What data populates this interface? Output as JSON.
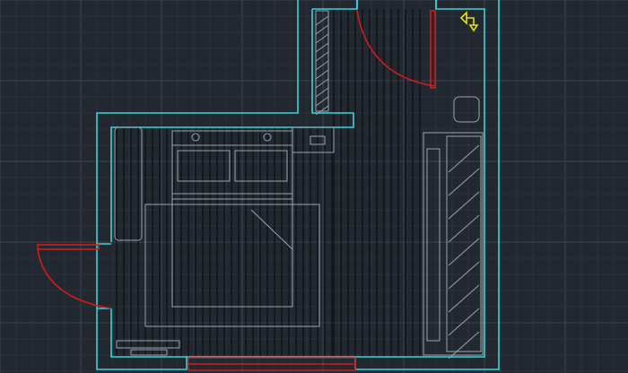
{
  "drawing": {
    "background_color": "#212830",
    "grid_major_color": "#3a4553",
    "grid_minor_color": "#2a323c",
    "wall_color": "#30d8e0",
    "furniture_color": "#9aa3ad",
    "floor_line_color": "#0b0d10",
    "door_color": "#d21b1b",
    "ucs_icon_color": "#e8e200",
    "grid_visible": true,
    "elements": [
      {
        "name": "exterior-walls",
        "kind": "walls"
      },
      {
        "name": "floor-planks",
        "kind": "flooring"
      },
      {
        "name": "top-door",
        "kind": "door",
        "swing": "arc"
      },
      {
        "name": "left-door",
        "kind": "door",
        "swing": "arc"
      },
      {
        "name": "bottom-window",
        "kind": "window"
      },
      {
        "name": "double-bed",
        "kind": "furniture"
      },
      {
        "name": "nightstand",
        "kind": "furniture"
      },
      {
        "name": "desk-shelf",
        "kind": "furniture"
      },
      {
        "name": "wardrobe",
        "kind": "furniture"
      },
      {
        "name": "mirror-panel",
        "kind": "furniture"
      },
      {
        "name": "toilet-fixture",
        "kind": "furniture"
      },
      {
        "name": "ucs-icon",
        "kind": "icon"
      }
    ]
  }
}
